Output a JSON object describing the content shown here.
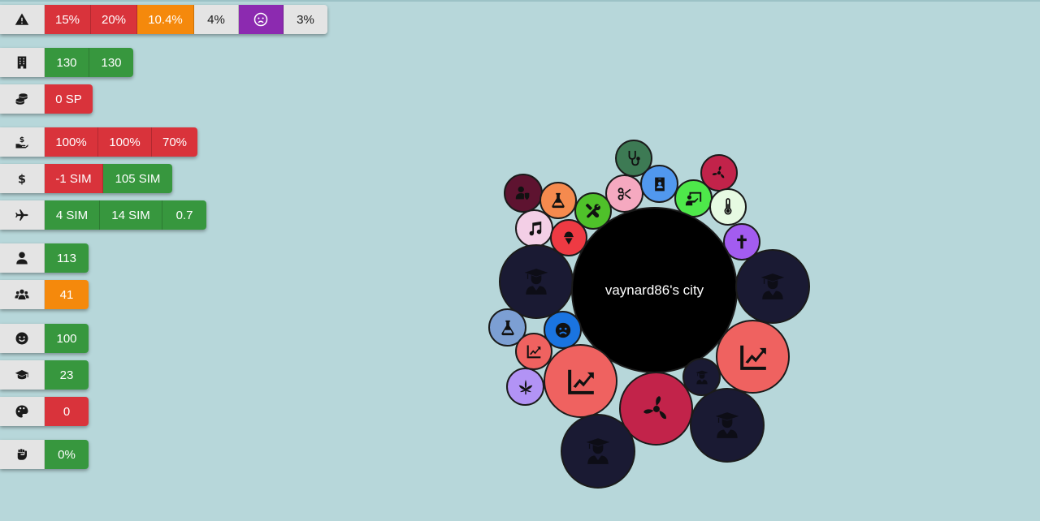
{
  "stats": {
    "alerts": {
      "icon": "warning-icon",
      "values": [
        "15%",
        "20%",
        "10.4%",
        "4%",
        "3%"
      ],
      "mood_icon": "sad-face-icon"
    },
    "buildings": {
      "icon": "building-icon",
      "values": [
        "130",
        "130"
      ]
    },
    "savings": {
      "icon": "coins-icon",
      "values": [
        "0 SP"
      ]
    },
    "subsidies": {
      "icon": "hand-money-icon",
      "values": [
        "100%",
        "100%",
        "70%"
      ]
    },
    "money": {
      "icon": "dollar-icon",
      "values": [
        "-1 SIM",
        "105 SIM"
      ]
    },
    "tourism": {
      "icon": "airplane-icon",
      "values": [
        "4 SIM",
        "14 SIM",
        "0.7"
      ]
    },
    "population": {
      "icon": "person-icon",
      "values": [
        "113"
      ]
    },
    "groups": {
      "icon": "group-icon",
      "values": [
        "41"
      ]
    },
    "happiness": {
      "icon": "smile-icon",
      "values": [
        "100"
      ]
    },
    "education": {
      "icon": "graduation-cap-icon",
      "values": [
        "23"
      ]
    },
    "culture": {
      "icon": "palette-icon",
      "values": [
        "0"
      ]
    },
    "protest": {
      "icon": "fist-icon",
      "values": [
        "0%"
      ]
    }
  },
  "city": {
    "name": "vaynard86's city"
  },
  "colors": {
    "background": "#b7d7da",
    "red": "#d9333b",
    "green": "#37973e",
    "orange": "#f5890c",
    "purple": "#8c2ab0",
    "navy": "#1a1a33",
    "salmon": "#ef6260",
    "crimson": "#c2234a"
  },
  "bubbles": [
    "stethoscope-icon",
    "fan-icon",
    "theater-masks-icon",
    "flask-icon",
    "scissors-icon",
    "id-card-icon",
    "teacher-icon",
    "thermometer-icon",
    "tools-icon",
    "music-icon",
    "ice-cream-icon",
    "cross-icon",
    "graduation-cap-icon",
    "sad-face-icon",
    "chart-line-icon",
    "cannabis-icon"
  ]
}
